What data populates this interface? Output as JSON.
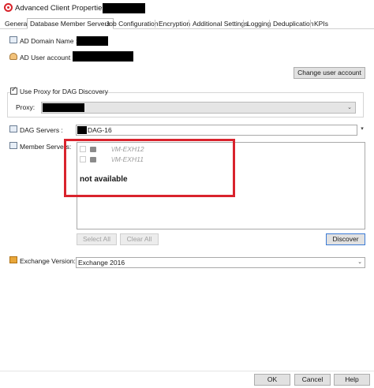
{
  "window": {
    "title": "Advanced Client Properties for",
    "icon": "commvault-icon"
  },
  "tabs": [
    {
      "label": "General",
      "active": false
    },
    {
      "label": "Database Member Servers",
      "active": true
    },
    {
      "label": "Job Configuration",
      "active": false
    },
    {
      "label": "Encryption",
      "active": false
    },
    {
      "label": "Additional Settings",
      "active": false
    },
    {
      "label": "Logging",
      "active": false
    },
    {
      "label": "Deduplication",
      "active": false
    },
    {
      "label": "KPIs",
      "active": false
    }
  ],
  "ad": {
    "domain_label": "AD Domain Name :",
    "user_label": "AD User account :",
    "change_button": "Change user account"
  },
  "proxy": {
    "checkbox_label": "Use Proxy for DAG Discovery",
    "checked": true,
    "proxy_label": "Proxy:"
  },
  "dag": {
    "label": "DAG Servers :",
    "value": "DAG-16"
  },
  "members": {
    "label": "Member Servers:",
    "items": [
      {
        "name": "\\/M-EXH12"
      },
      {
        "name": "\\/M-EXH11"
      }
    ],
    "annotation": "not available",
    "select_all": "Select All",
    "clear_all": "Clear All",
    "discover": "Discover"
  },
  "exchange": {
    "label": "Exchange Version:",
    "value": "Exchange 2016"
  },
  "footer": {
    "ok": "OK",
    "cancel": "Cancel",
    "help": "Help"
  },
  "colors": {
    "annotation_red": "#d9232d",
    "focus_blue": "#3b7bd6"
  }
}
